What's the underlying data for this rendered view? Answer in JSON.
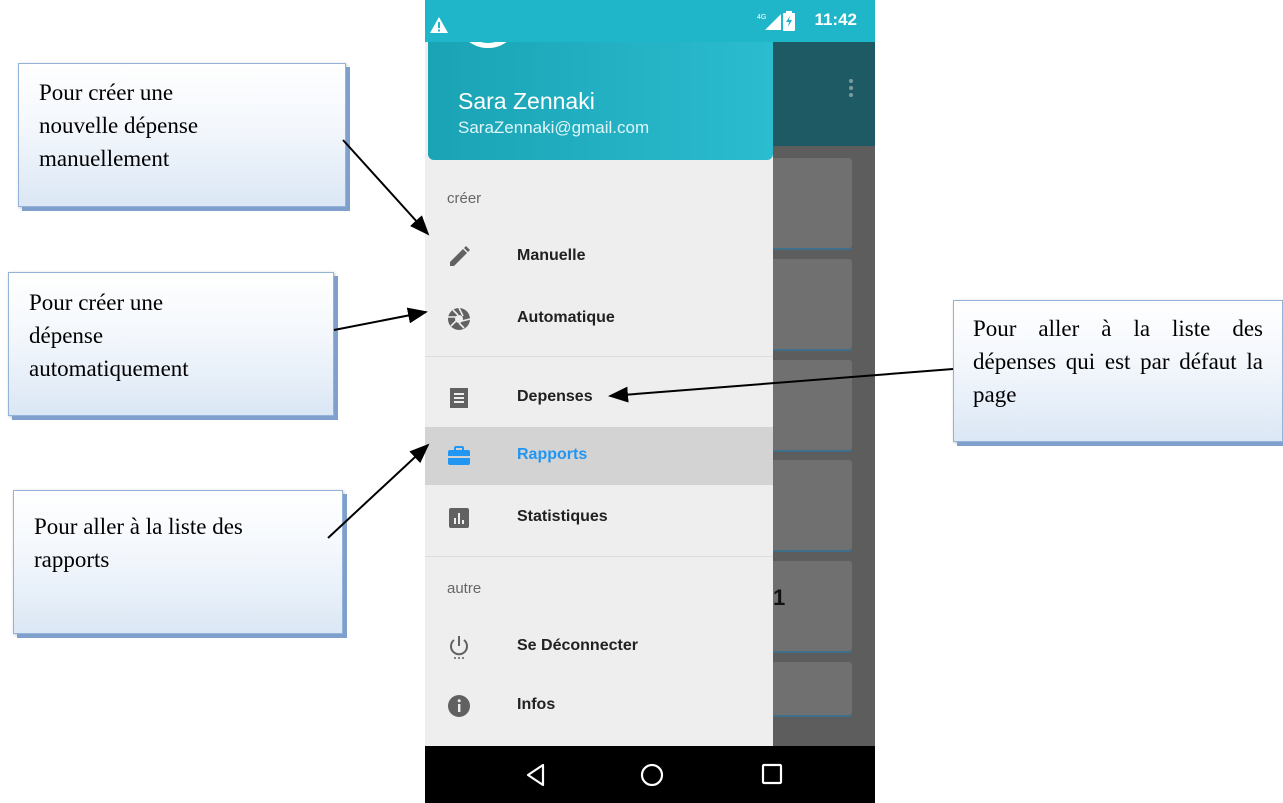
{
  "status_bar": {
    "time": "11:42",
    "network_label": "4G"
  },
  "drawer": {
    "user_name": "Sara Zennaki",
    "user_email": "SaraZennaki@gmail.com",
    "section_create": "créer",
    "section_other": "autre",
    "items": [
      {
        "label": "Manuelle",
        "icon": "pencil-icon"
      },
      {
        "label": "Automatique",
        "icon": "camera-shutter-icon"
      },
      {
        "label": "Depenses",
        "icon": "receipt-icon"
      },
      {
        "label": "Rapports",
        "icon": "briefcase-icon",
        "active": true
      },
      {
        "label": "Statistiques",
        "icon": "bar-chart-icon"
      },
      {
        "label": "Se Déconnecter",
        "icon": "power-icon"
      },
      {
        "label": "Infos",
        "icon": "info-icon"
      }
    ],
    "active_color": "#2196f3",
    "header_color": "#1fb6c9"
  },
  "background_app": {
    "partial_number": "1"
  },
  "callouts": {
    "manual": "Pour créer une\nnouvelle dépense\nmanuellement",
    "automatic": "Pour créer une\ndépense\nautomatiquement",
    "reports": "Pour aller à la liste des\nrapports",
    "expenses": "Pour aller à la liste des dépenses qui est par défaut la page"
  }
}
